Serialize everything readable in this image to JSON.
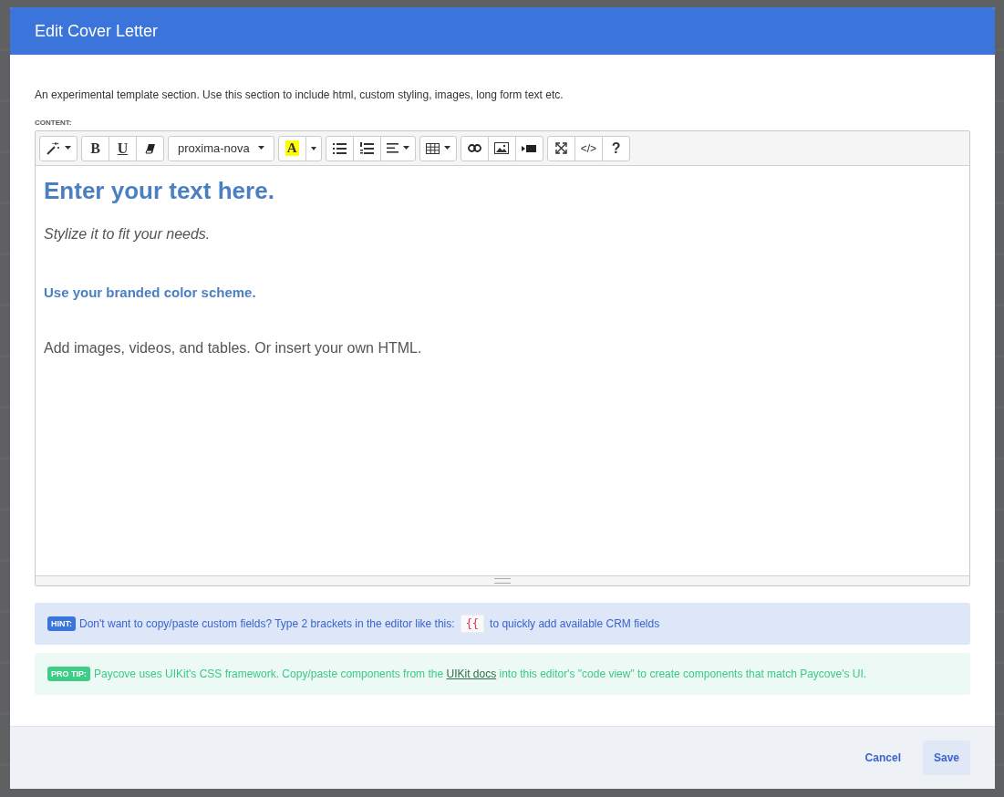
{
  "dialog": {
    "title": "Edit Cover Letter",
    "description": "An experimental template section. Use this section to include html, custom styling, images, long form text etc.",
    "content_label": "CONTENT:"
  },
  "toolbar": [
    {
      "buttons": [
        {
          "kind": "magic",
          "dropdown": true
        }
      ]
    },
    {
      "buttons": [
        {
          "kind": "bold",
          "label": "B"
        },
        {
          "kind": "underline",
          "label": "U"
        },
        {
          "kind": "eraser"
        }
      ]
    },
    {
      "buttons": [
        {
          "kind": "font",
          "label": "proxima-nova",
          "dropdown": true
        }
      ]
    },
    {
      "buttons": [
        {
          "kind": "color",
          "label": "A"
        },
        {
          "kind": "caret"
        }
      ]
    },
    {
      "buttons": [
        {
          "kind": "bullets"
        },
        {
          "kind": "numbers"
        },
        {
          "kind": "align",
          "dropdown": true
        }
      ]
    },
    {
      "buttons": [
        {
          "kind": "table",
          "dropdown": true
        }
      ]
    },
    {
      "buttons": [
        {
          "kind": "link"
        },
        {
          "kind": "image"
        },
        {
          "kind": "video"
        }
      ]
    },
    {
      "buttons": [
        {
          "kind": "fullscreen"
        },
        {
          "kind": "code",
          "label": "</>"
        },
        {
          "kind": "help",
          "label": "?"
        }
      ]
    }
  ],
  "editor": {
    "lines": [
      {
        "kind": "heading",
        "text": "Enter your text here."
      },
      {
        "kind": "italic",
        "text": "Stylize it to fit your needs."
      },
      {
        "kind": "subheading",
        "text": "Use your branded color scheme."
      },
      {
        "kind": "paragraph",
        "text": "Add images, videos, and tables. Or insert your own HTML."
      }
    ]
  },
  "hint": {
    "badge": "HINT:",
    "before": "Don't want to copy/paste custom fields? Type 2 brackets in the editor like this:",
    "code": "{{",
    "after": "to quickly add available CRM fields"
  },
  "pro_tip": {
    "badge": "PRO TIP:",
    "before": "Paycove uses UIKit's CSS framework. Copy/paste components from the",
    "link": "UIKit docs",
    "after": "into this editor's \"code view\" to create components that match Paycove's UI."
  },
  "buttons": [
    {
      "kind": "cancel",
      "label": "Cancel"
    },
    {
      "kind": "save",
      "label": "Save"
    }
  ]
}
